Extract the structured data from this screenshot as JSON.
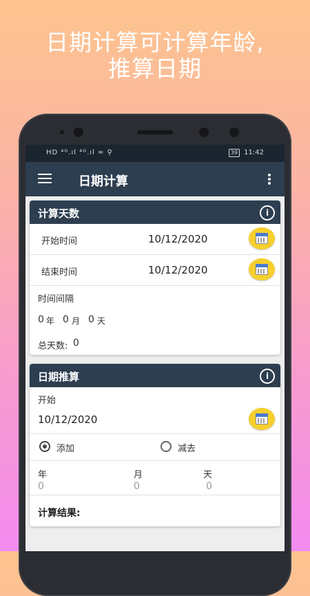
{
  "promo": {
    "line1": "日期计算可计算年龄,",
    "line2": "推算日期"
  },
  "statusbar": {
    "left": "HD ⁴ᴳ.ıl ⁴ᴳ.ıl ≈ ⚲",
    "battery": "39",
    "time": "11:42"
  },
  "appbar": {
    "title": "日期计算",
    "menu_icon": "hamburger-menu-icon",
    "overflow_icon": "more-vert-icon"
  },
  "card1": {
    "title": "计算天数",
    "info_icon": "info-icon",
    "start_label": "开始时间",
    "start_value": "10/12/2020",
    "end_label": "结束时间",
    "end_value": "10/12/2020",
    "interval_label": "时间间隔",
    "years_value": "0",
    "years_unit": "年",
    "months_value": "0",
    "months_unit": "月",
    "days_value": "0",
    "days_unit": "天",
    "total_label": "总天数:",
    "total_value": "0"
  },
  "card2": {
    "title": "日期推算",
    "info_icon": "info-icon",
    "start_label": "开始",
    "start_value": "10/12/2020",
    "add_label": "添加",
    "subtract_label": "减去",
    "selected_mode": "添加",
    "year_label": "年",
    "month_label": "月",
    "day_label": "天",
    "year_placeholder": "0",
    "month_placeholder": "0",
    "day_placeholder": "0",
    "result_label": "计算结果:"
  },
  "colors": {
    "appbar": "#2d3e50",
    "statusbar": "#1b2530",
    "calendar_button": "#f6cf2d",
    "background": "#eeeeee"
  }
}
